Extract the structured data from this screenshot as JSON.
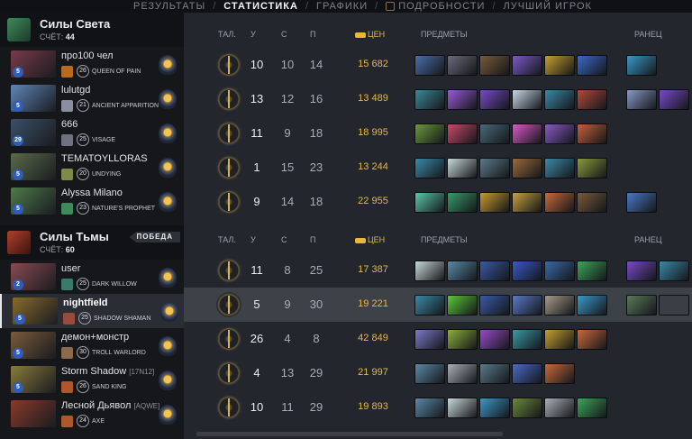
{
  "nav": {
    "tabs": [
      "РЕЗУЛЬТАТЫ",
      "СТАТИСТИКА",
      "ГРАФИКИ",
      "ПОДРОБНОСТИ",
      "ЛУЧШИЙ ИГРОК"
    ],
    "active_tab": "СТАТИСТИКА"
  },
  "columns": {
    "talents": "ТАЛ.",
    "kills": "У",
    "deaths": "С",
    "assists": "П",
    "net_worth": "ЦЕН",
    "items": "ПРЕДМЕТЫ",
    "backpack": "РАНЕЦ"
  },
  "radiant": {
    "name": "Силы Света",
    "score_label": "СЧЁТ:",
    "score": "44",
    "players": [
      {
        "name": "про100 чел",
        "tag": "",
        "level": "5",
        "hero_level": "26",
        "hero": "QUEEN OF PAIN",
        "k": "10",
        "d": "10",
        "a": "14",
        "nw": "15 682",
        "color": "#7a3b49",
        "rank_color": "#b86b1f"
      },
      {
        "name": "lulutgd",
        "tag": "",
        "level": "5",
        "hero_level": "21",
        "hero": "ANCIENT APPARITION",
        "k": "13",
        "d": "12",
        "a": "16",
        "nw": "13 489",
        "color": "#5e86b8",
        "rank_color": "#8a8fa0"
      },
      {
        "name": "666",
        "tag": "",
        "level": "29",
        "hero_level": "25",
        "hero": "VISAGE",
        "k": "11",
        "d": "9",
        "a": "18",
        "nw": "18 995",
        "color": "#3a5168",
        "rank_color": "#6d7380"
      },
      {
        "name": "TEMATOYLLORAS",
        "tag": "",
        "level": "5",
        "hero_level": "20",
        "hero": "UNDYING",
        "k": "1",
        "d": "15",
        "a": "23",
        "nw": "13 244",
        "color": "#5a6b4a",
        "rank_color": "#7a8b4a"
      },
      {
        "name": "Alyssa Milano",
        "tag": "",
        "level": "5",
        "hero_level": "23",
        "hero": "NATURE'S PROPHET",
        "k": "9",
        "d": "14",
        "a": "18",
        "nw": "22 955",
        "color": "#4f7a4a",
        "rank_color": "#3e8a5a"
      }
    ]
  },
  "dire": {
    "name": "Силы Тьмы",
    "score_label": "СЧЁТ:",
    "score": "60",
    "victory": "ПОБЕДА",
    "players": [
      {
        "name": "user",
        "tag": "",
        "level": "2",
        "hero_level": "25",
        "hero": "DARK WILLOW",
        "k": "11",
        "d": "8",
        "a": "25",
        "nw": "17 387",
        "color": "#8a4a52",
        "rank_color": "#3a7a6a"
      },
      {
        "name": "nightfield",
        "tag": "",
        "level": "5",
        "hero_level": "25",
        "hero": "SHADOW SHAMAN",
        "k": "5",
        "d": "9",
        "a": "30",
        "nw": "19 221",
        "color": "#8a6a2a",
        "rank_color": "#9a4a3a"
      },
      {
        "name": "демон+монстр",
        "tag": "",
        "level": "5",
        "hero_level": "30",
        "hero": "TROLL WARLORD",
        "k": "26",
        "d": "4",
        "a": "8",
        "nw": "42 849",
        "color": "#7a5a3a",
        "rank_color": "#8a6a4a"
      },
      {
        "name": "Storm Shadow",
        "tag": "[17N12]",
        "level": "5",
        "hero_level": "26",
        "hero": "SAND KING",
        "k": "4",
        "d": "13",
        "a": "29",
        "nw": "21 997",
        "color": "#8a7a3a",
        "rank_color": "#b0562a"
      },
      {
        "name": "Лесной Дьявол",
        "tag": "[AQWE]",
        "level": "",
        "hero_level": "24",
        "hero": "AXE",
        "k": "10",
        "d": "11",
        "a": "29",
        "nw": "19 893",
        "color": "#8a3a2a",
        "rank_color": "#b0562a"
      }
    ]
  },
  "items": {
    "radiant": [
      [
        "#4a6fa8",
        "#6a6a7a",
        "#7a5a3a",
        "#7a5ac8",
        "#c8a030",
        "#3a6ac8"
      ],
      [
        "#3a8a9a",
        "#9a5ad8",
        "#7a4ac8",
        "#c8d8e8",
        "#3a8aa8",
        "#b04a3a"
      ],
      [
        "#6a9a3a",
        "#c84a6a",
        "#4a6a7a",
        "#d85ac8",
        "#8a5ac8",
        "#c8603a"
      ],
      [
        "#3a8aa8",
        "#c8d8d8",
        "#5a7a8a",
        "#9a6a3a",
        "#3a8aa8",
        "#8a9a3a"
      ],
      [
        "#5ac8a8",
        "#3a9a6a",
        "#c89a30",
        "#c8a040",
        "#c86a3a",
        "#7a5a3a"
      ]
    ],
    "radiant_backpack": [
      [
        "#3a9ac8"
      ],
      [
        "#8a9ac8",
        "#7a4ac8"
      ],
      [],
      [],
      [
        "#4a7ac8"
      ]
    ],
    "dire": [
      [
        "#c8d8d8",
        "#5a8aa8",
        "#3a5aa8",
        "#3a5ac8",
        "#3a6aa8",
        "#3aa85a"
      ],
      [
        "#3a8aa8",
        "#5ac83a",
        "#3a5aa8",
        "#5a7ac8",
        "#a89a8a",
        "#3a9ac8"
      ],
      [
        "#7a7ac8",
        "#8ab03a",
        "#9a4ac8",
        "#3a9aa8",
        "#c8a030",
        "#c86a3a"
      ],
      [
        "#5a8aa8",
        "#a8b0b8",
        "#5a7a8a",
        "#4a6ac8",
        "#c86a3a"
      ],
      [
        "#5a8aa8",
        "#c8d8d8",
        "#3a9ac8",
        "#6a8a3a",
        "#a8b0b8",
        "#3aa85a"
      ]
    ],
    "dire_backpack": [
      [
        "#7a4ac8",
        "#3a8aa8"
      ],
      [
        "#5a7a5a",
        ""
      ],
      [],
      [],
      []
    ]
  }
}
